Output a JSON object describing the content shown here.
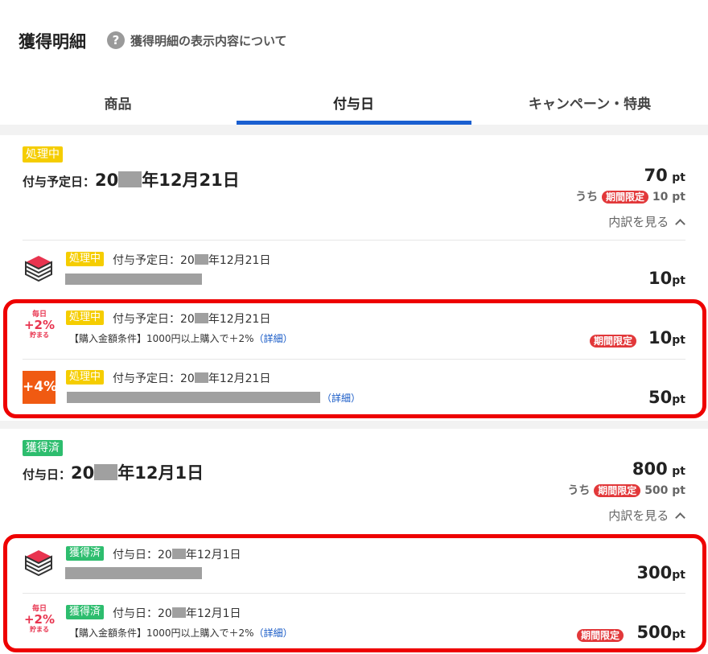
{
  "header": {
    "title": "獲得明細",
    "help_icon_glyph": "?",
    "help_link": "獲得明細の表示内容について"
  },
  "tabs": [
    {
      "label": "商品"
    },
    {
      "label": "付与日"
    },
    {
      "label": "キャンペーン・特典"
    }
  ],
  "active_tab": 1,
  "accent_color": "#1a5fd0",
  "pt_unit": "pt",
  "groups": [
    {
      "status": "処理中",
      "date_label": "付与予定日：",
      "date_year_prefix": "20",
      "date_rest": "年12月21日",
      "total": "70",
      "uchi": "うち",
      "limited_label": "期間限定",
      "limited_value": "10 pt",
      "breakdown_link": "内訳を見る",
      "items": [
        {
          "icon": "book-stack-icon",
          "status": "処理中",
          "date_prefix": "付与予定日：20",
          "date_rest": "年12月21日",
          "desc": "",
          "detail_link": "",
          "limited": "",
          "points": "10"
        },
        {
          "icon": "plus-2-percent-icon",
          "icon_text_top": "毎日",
          "icon_text_mid": "+2%",
          "icon_text_bot": "貯まる",
          "status": "処理中",
          "date_prefix": "付与予定日：20",
          "date_rest": "年12月21日",
          "desc": "【購入金額条件】1000円以上購入で＋2%",
          "detail_link": "（詳細）",
          "limited": "期間限定",
          "points": "10"
        },
        {
          "icon": "plus-4-percent-icon",
          "icon_text_mid": "+4%",
          "status": "処理中",
          "date_prefix": "付与予定日：20",
          "date_rest": "年12月21日",
          "desc": "",
          "detail_link": "（詳細）",
          "limited": "",
          "points": "50"
        }
      ]
    },
    {
      "status": "獲得済",
      "date_label": "付与日：",
      "date_year_prefix": "20",
      "date_rest": "年12月1日",
      "total": "800",
      "uchi": "うち",
      "limited_label": "期間限定",
      "limited_value": "500 pt",
      "breakdown_link": "内訳を見る",
      "items": [
        {
          "icon": "book-stack-icon",
          "status": "獲得済",
          "date_prefix": "付与日：20",
          "date_rest": "年12月1日",
          "desc": "",
          "detail_link": "",
          "limited": "",
          "points": "300"
        },
        {
          "icon": "plus-2-percent-icon",
          "icon_text_top": "毎日",
          "icon_text_mid": "+2%",
          "icon_text_bot": "貯まる",
          "status": "獲得済",
          "date_prefix": "付与日：20",
          "date_rest": "年12月1日",
          "desc": "【購入金額条件】1000円以上購入で＋2%",
          "detail_link": "（詳細）",
          "limited": "期間限定",
          "points": "500"
        }
      ]
    }
  ]
}
